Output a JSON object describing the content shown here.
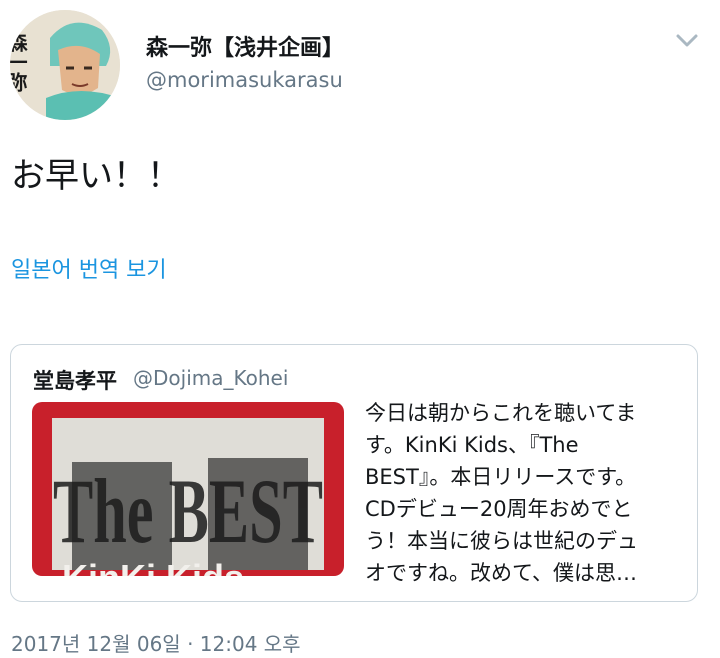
{
  "author": {
    "display_name": "森一弥【浅井企画】",
    "handle": "@morimasukarasu",
    "avatar_text": "森一弥"
  },
  "tweet": {
    "text": "お早い！！",
    "translate_link": "일본어 번역 보기",
    "timestamp": "2017년 12월 06일 · 12:04 오후"
  },
  "quote": {
    "author_name": "堂島孝平",
    "author_handle": "@Dojima_Kohei",
    "media_title_text": "The BEST",
    "media_subtitle_text": "KinKi Kids",
    "text_lines": [
      "今日は朝からこれを聴いてま",
      "す。KinKi Kids、『The",
      "BEST』。本日リリースです。",
      "CDデビュー20周年おめでと",
      "う！本当に彼らは世紀のデュ",
      "オですね。改めて、僕は思…"
    ]
  },
  "icons": {
    "menu_caret": "chevron-down-icon"
  },
  "colors": {
    "link": "#1b95e0",
    "secondary_text": "#657786",
    "border": "#ccd6dd",
    "album_red": "#c8202b"
  }
}
